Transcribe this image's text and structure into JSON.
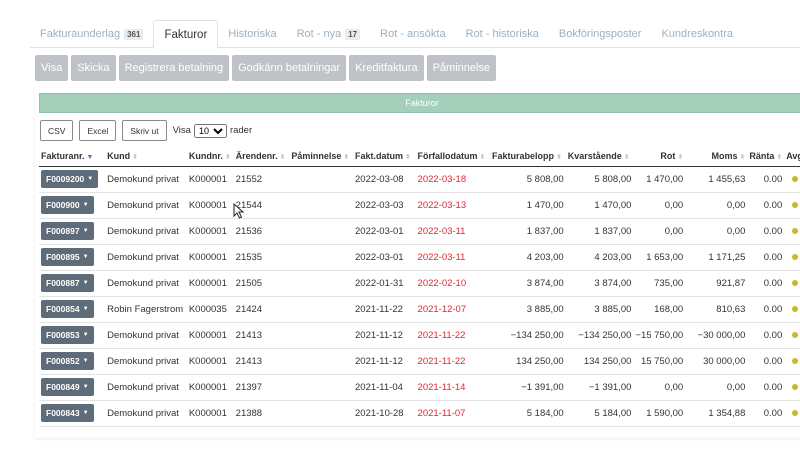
{
  "tabs": [
    {
      "label": "Fakturaunderlag",
      "badge": "361"
    },
    {
      "label": "Fakturor",
      "badge": ""
    },
    {
      "label": "Historiska",
      "badge": ""
    },
    {
      "label": "Rot - nya",
      "badge": "17"
    },
    {
      "label": "Rot - ansökta",
      "badge": ""
    },
    {
      "label": "Rot - historiska",
      "badge": ""
    },
    {
      "label": "Bokföringsposter",
      "badge": ""
    },
    {
      "label": "Kundreskontra",
      "badge": ""
    }
  ],
  "actions": [
    "Visa",
    "Skicka",
    "Registrera betalning",
    "Godkänn betalningar",
    "Kreditfaktura",
    "Påminnelse"
  ],
  "panel": {
    "title": "Fakturor"
  },
  "tools": {
    "csv": "CSV",
    "excel": "Excel",
    "print": "Skriv ut",
    "show_prefix": "Visa",
    "page_size": "10",
    "show_suffix": "rader"
  },
  "columns": [
    "Fakturanr.",
    "Kund",
    "Kundnr.",
    "Ärendenr.",
    "Påminnelse",
    "Fakt.datum",
    "Förfallodatum",
    "Fakturabelopp",
    "Kvarstående",
    "Rot",
    "Moms",
    "Ränta",
    "Avg"
  ],
  "rows": [
    {
      "nr": "F0009200",
      "kund": "Demokund privat",
      "kundnr": "K000001",
      "arende": "21552",
      "pam": "",
      "fakt": "2022-03-08",
      "forfall": "2022-03-18",
      "belopp": "5 808,00",
      "kvar": "5 808,00",
      "rot": "1 470,00",
      "moms": "1 455,63",
      "ranta": "0.00"
    },
    {
      "nr": "F000900",
      "kund": "Demokund privat",
      "kundnr": "K000001",
      "arende": "21544",
      "pam": "",
      "fakt": "2022-03-03",
      "forfall": "2022-03-13",
      "belopp": "1 470,00",
      "kvar": "1 470,00",
      "rot": "0,00",
      "moms": "0,00",
      "ranta": "0.00"
    },
    {
      "nr": "F000897",
      "kund": "Demokund privat",
      "kundnr": "K000001",
      "arende": "21536",
      "pam": "",
      "fakt": "2022-03-01",
      "forfall": "2022-03-11",
      "belopp": "1 837,00",
      "kvar": "1 837,00",
      "rot": "0,00",
      "moms": "0,00",
      "ranta": "0.00"
    },
    {
      "nr": "F000895",
      "kund": "Demokund privat",
      "kundnr": "K000001",
      "arende": "21535",
      "pam": "",
      "fakt": "2022-03-01",
      "forfall": "2022-03-11",
      "belopp": "4 203,00",
      "kvar": "4 203,00",
      "rot": "1 653,00",
      "moms": "1 171,25",
      "ranta": "0.00"
    },
    {
      "nr": "F000887",
      "kund": "Demokund privat",
      "kundnr": "K000001",
      "arende": "21505",
      "pam": "",
      "fakt": "2022-01-31",
      "forfall": "2022-02-10",
      "belopp": "3 874,00",
      "kvar": "3 874,00",
      "rot": "735,00",
      "moms": "921,87",
      "ranta": "0.00"
    },
    {
      "nr": "F000854",
      "kund": "Robin Fagerstrom",
      "kundnr": "K000035",
      "arende": "21424",
      "pam": "",
      "fakt": "2021-11-22",
      "forfall": "2021-12-07",
      "belopp": "3 885,00",
      "kvar": "3 885,00",
      "rot": "168,00",
      "moms": "810,63",
      "ranta": "0.00"
    },
    {
      "nr": "F000853",
      "kund": "Demokund privat",
      "kundnr": "K000001",
      "arende": "21413",
      "pam": "",
      "fakt": "2021-11-12",
      "forfall": "2021-11-22",
      "belopp": "−134 250,00",
      "kvar": "−134 250,00",
      "rot": "−15 750,00",
      "moms": "−30 000,00",
      "ranta": "0.00"
    },
    {
      "nr": "F000852",
      "kund": "Demokund privat",
      "kundnr": "K000001",
      "arende": "21413",
      "pam": "",
      "fakt": "2021-11-12",
      "forfall": "2021-11-22",
      "belopp": "134 250,00",
      "kvar": "134 250,00",
      "rot": "15 750,00",
      "moms": "30 000,00",
      "ranta": "0.00"
    },
    {
      "nr": "F000849",
      "kund": "Demokund privat",
      "kundnr": "K000001",
      "arende": "21397",
      "pam": "",
      "fakt": "2021-11-04",
      "forfall": "2021-11-14",
      "belopp": "−1 391,00",
      "kvar": "−1 391,00",
      "rot": "0,00",
      "moms": "0,00",
      "ranta": "0.00"
    },
    {
      "nr": "F000843",
      "kund": "Demokund privat",
      "kundnr": "K000001",
      "arende": "21388",
      "pam": "",
      "fakt": "2021-10-28",
      "forfall": "2021-11-07",
      "belopp": "5 184,00",
      "kvar": "5 184,00",
      "rot": "1 590,00",
      "moms": "1 354,88",
      "ranta": "0.00"
    }
  ],
  "colors": {
    "panel_header": "#a3cfbb",
    "invoice_button": "#5d6c78",
    "due_date": "#e0262e",
    "action_button": "#bfc3c7"
  }
}
